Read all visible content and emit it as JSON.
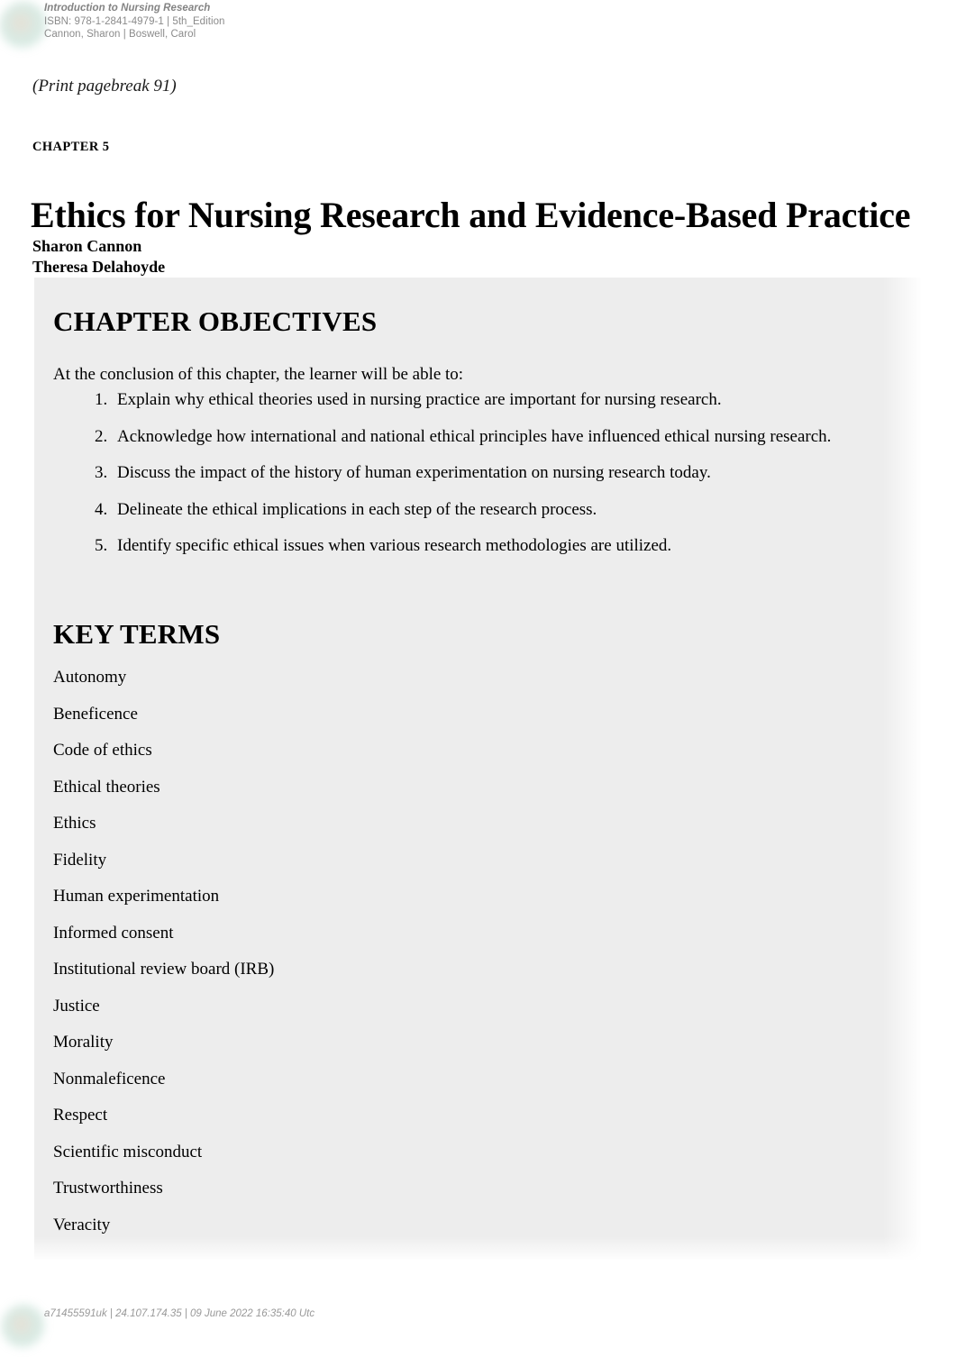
{
  "running_head": {
    "book_title": "Introduction to Nursing Research",
    "isbn_line": "ISBN: 978-1-2841-4979-1 | 5th_Edition",
    "authors_line": "Cannon, Sharon | Boswell, Carol"
  },
  "page": {
    "pagebreak_marker": "(Print pagebreak 91)",
    "chapter_label": "CHAPTER 5",
    "chapter_title": "Ethics for Nursing Research and Evidence-Based Practice",
    "author_1": "Sharon Cannon",
    "author_2": "Theresa Delahoyde"
  },
  "objectives": {
    "heading": "CHAPTER OBJECTIVES",
    "lead_in": "At the conclusion of this chapter, the learner will be able to:",
    "items": [
      "Explain why ethical theories used in nursing practice are important for nursing research.",
      "Acknowledge how international and national ethical principles have influenced ethical nursing research.",
      "Discuss the impact of the history of human experimentation on nursing research today.",
      "Delineate the ethical implications in each step of the research process.",
      "Identify specific ethical issues when various research methodologies are utilized."
    ]
  },
  "key_terms": {
    "heading": "KEY TERMS",
    "items": [
      "Autonomy",
      "Beneficence",
      "Code of ethics",
      "Ethical theories",
      "Ethics",
      "Fidelity",
      "Human experimentation",
      "Informed consent",
      "Institutional review board (IRB)",
      "Justice",
      "Morality",
      "Nonmaleficence",
      "Respect",
      "Scientific misconduct",
      "Trustworthiness",
      "Veracity"
    ]
  },
  "footer": {
    "stamp": "a71455591uk | 24.107.174.35 | 09 June 2022 16:35:40 Utc"
  },
  "colors": {
    "panel_background": "#ededed",
    "page_background": "#ffffff",
    "running_head_text": "#8b8b8b",
    "footer_text": "#999999",
    "body_text": "#000000"
  }
}
